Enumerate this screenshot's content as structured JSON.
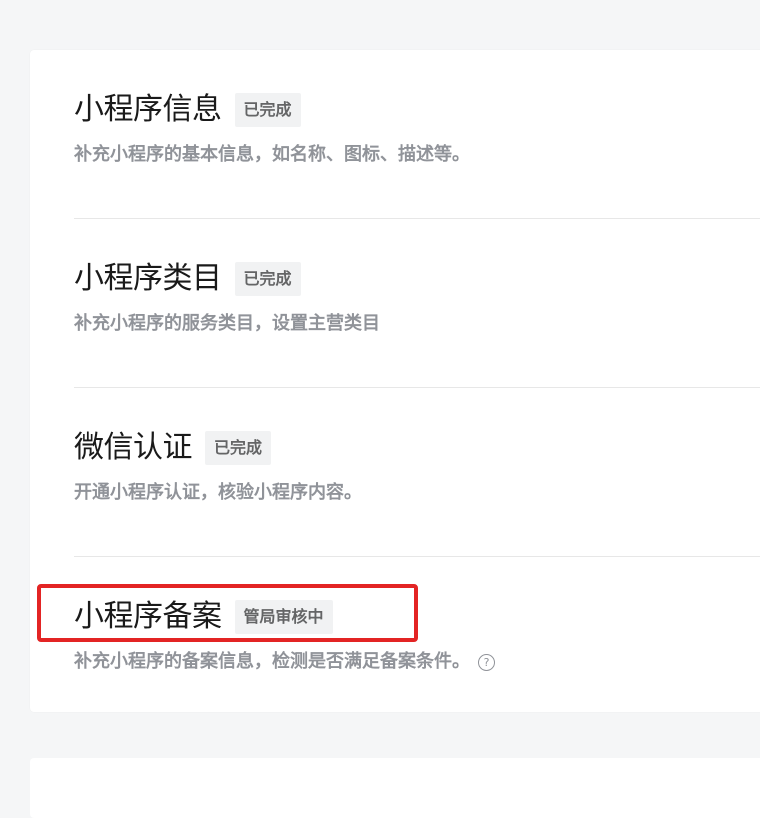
{
  "sections": [
    {
      "title": "小程序信息",
      "status": "已完成",
      "desc": "补充小程序的基本信息，如名称、图标、描述等。"
    },
    {
      "title": "小程序类目",
      "status": "已完成",
      "desc": "补充小程序的服务类目，设置主营类目"
    },
    {
      "title": "微信认证",
      "status": "已完成",
      "desc": "开通小程序认证，核验小程序内容。"
    },
    {
      "title": "小程序备案",
      "status": "管局审核中",
      "desc": "补充小程序的备案信息，检测是否满足备案条件。"
    }
  ],
  "help_icon_glyph": "?",
  "highlight_color": "#e32424"
}
